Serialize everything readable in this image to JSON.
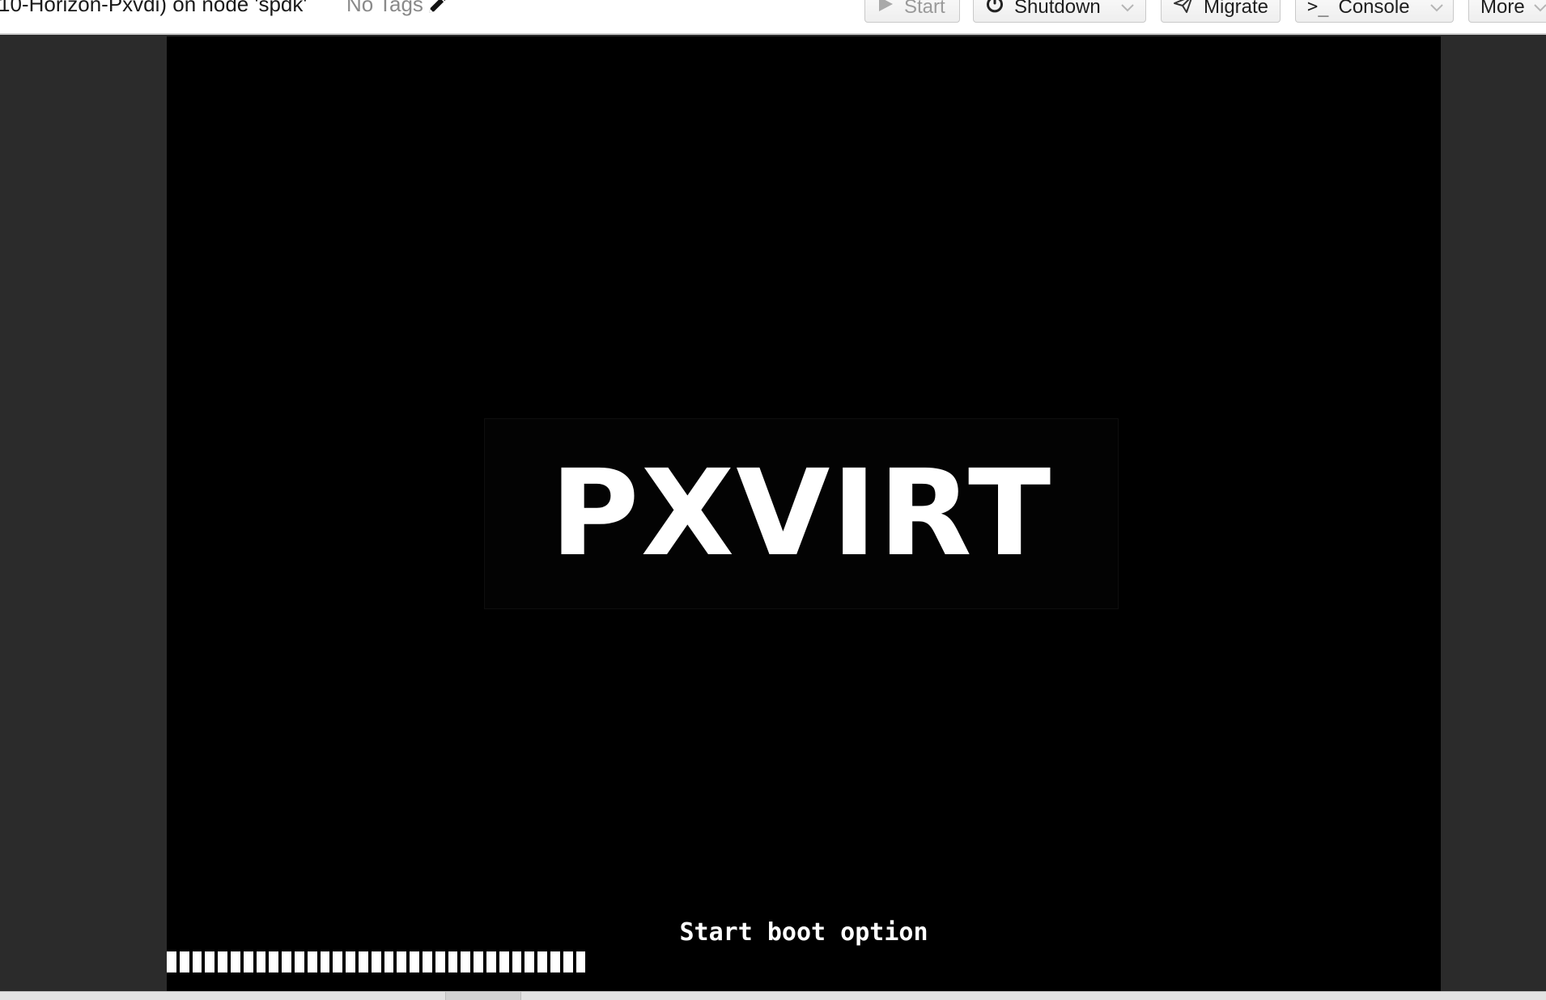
{
  "header": {
    "vm_title": "10-Horizon-Pxvdi) on node 'spdk'",
    "tags_label": "No Tags",
    "buttons": {
      "start": "Start",
      "shutdown": "Shutdown",
      "migrate": "Migrate",
      "console_prompt": ">_",
      "console": "Console",
      "more": "More"
    }
  },
  "console": {
    "logo_text": "PXVIRT",
    "boot_message": "Start boot option",
    "progress_blocks": 33,
    "background_color": "#000000",
    "frame_color": "#2b2b2b"
  },
  "icons": {
    "start": "play-icon",
    "shutdown": "power-icon",
    "migrate": "paper-plane-icon",
    "tags_edit": "pencil-icon",
    "dropdown": "chevron-down-icon"
  }
}
